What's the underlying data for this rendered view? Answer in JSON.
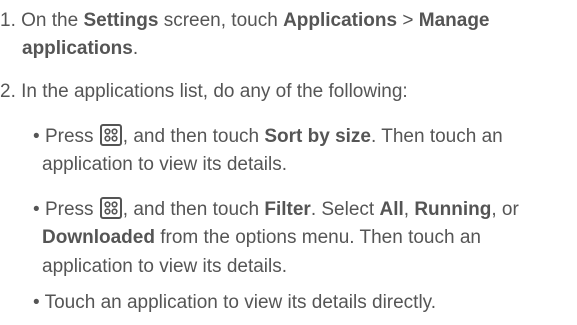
{
  "steps": [
    {
      "number": "1.",
      "text_1": "On the",
      "bold_1": "Settings",
      "text_2": "screen, touch",
      "bold_2": "Applications",
      "text_3": ">",
      "bold_3": "Manage",
      "bold_4": "applications",
      "text_4": "."
    },
    {
      "number": "2.",
      "text_1": "In the applications list, do any of the following:"
    }
  ],
  "bullets": [
    {
      "marker": "•",
      "text_1": "Press",
      "icon": "menu-key-icon",
      "text_2": ", and then touch",
      "bold_1": "Sort by size",
      "text_3": ". Then touch an",
      "text_4": "application to view its details."
    },
    {
      "marker": "•",
      "text_1": "Press",
      "icon": "menu-key-icon",
      "text_2": ", and then touch",
      "bold_1": "Filter",
      "text_3": ". Select",
      "bold_2": "All",
      "text_4": ",",
      "bold_3": "Running",
      "text_5": ", or",
      "bold_4": "Downloaded",
      "text_6": "from the options menu. Then touch an",
      "text_7": "application to view its details."
    },
    {
      "marker": "•",
      "text_1": "Touch an application to view its details directly."
    }
  ]
}
